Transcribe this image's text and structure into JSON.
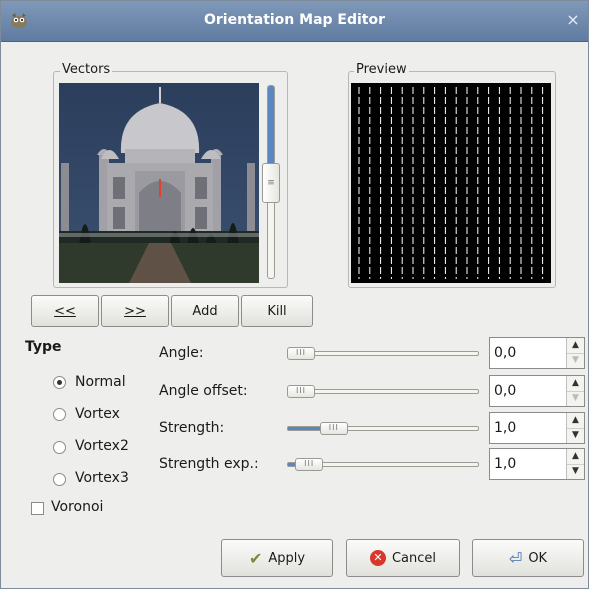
{
  "window": {
    "title": "Orientation Map Editor",
    "app_icon": "gimp-icon",
    "close_glyph": "×"
  },
  "vectors": {
    "label": "Vectors",
    "nav_prev": "<<",
    "nav_next": ">>",
    "add": "Add",
    "kill": "Kill",
    "scroll_position": 0.48
  },
  "preview": {
    "label": "Preview"
  },
  "type": {
    "heading": "Type",
    "options": [
      {
        "label": "Normal",
        "checked": true
      },
      {
        "label": "Vortex",
        "checked": false
      },
      {
        "label": "Vortex2",
        "checked": false
      },
      {
        "label": "Vortex3",
        "checked": false
      }
    ],
    "voronoi": {
      "label": "Voronoi",
      "checked": false
    }
  },
  "params": [
    {
      "label": "Angle:",
      "value": "0,0",
      "fraction": 0.0
    },
    {
      "label": "Angle offset:",
      "value": "0,0",
      "fraction": 0.0
    },
    {
      "label": "Strength:",
      "value": "1,0",
      "fraction": 0.2
    },
    {
      "label": "Strength exp.:",
      "value": "1,0",
      "fraction": 0.05
    }
  ],
  "buttons": {
    "apply": "Apply",
    "cancel": "Cancel",
    "ok": "OK"
  },
  "colors": {
    "accent": "#5a86c2",
    "titlebar": "#6c88ad",
    "preview_bg": "#000000"
  }
}
